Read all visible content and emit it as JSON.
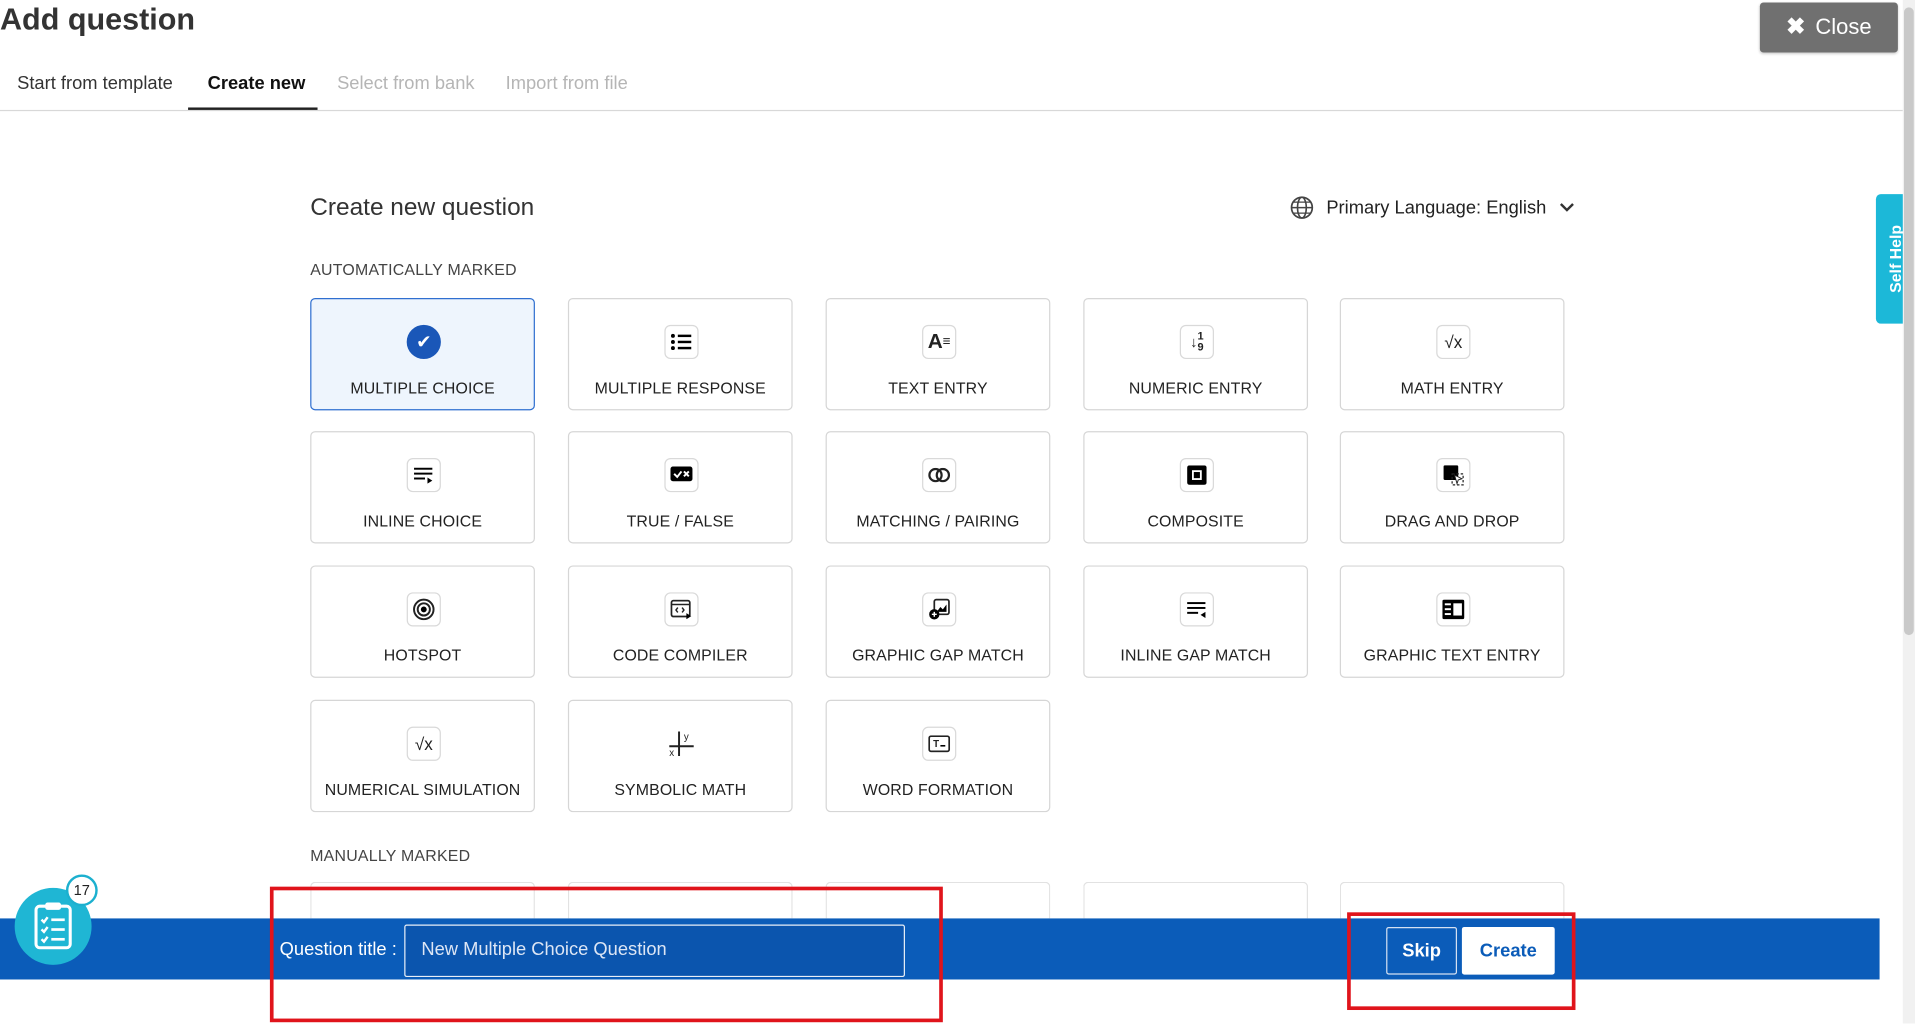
{
  "header": {
    "title": "Add question",
    "close_label": "Close"
  },
  "tabs": [
    {
      "label": "Start from template",
      "state": "normal"
    },
    {
      "label": "Create new",
      "state": "active"
    },
    {
      "label": "Select from bank",
      "state": "disabled"
    },
    {
      "label": "Import from file",
      "state": "disabled"
    }
  ],
  "main": {
    "section_title": "Create new question",
    "language_label": "Primary Language: English",
    "auto_label": "AUTOMATICALLY MARKED",
    "manual_label": "MANUALLY MARKED",
    "question_types": [
      {
        "label": "MULTIPLE CHOICE",
        "icon": "check-circle-icon",
        "selected": true
      },
      {
        "label": "MULTIPLE RESPONSE",
        "icon": "list-icon"
      },
      {
        "label": "TEXT ENTRY",
        "icon": "text-entry-icon"
      },
      {
        "label": "NUMERIC ENTRY",
        "icon": "numeric-sort-icon"
      },
      {
        "label": "MATH ENTRY",
        "icon": "sqrt-icon"
      },
      {
        "label": "INLINE CHOICE",
        "icon": "inline-choice-icon"
      },
      {
        "label": "TRUE / FALSE",
        "icon": "true-false-icon"
      },
      {
        "label": "MATCHING / PAIRING",
        "icon": "matching-icon"
      },
      {
        "label": "COMPOSITE",
        "icon": "composite-icon"
      },
      {
        "label": "DRAG AND DROP",
        "icon": "drag-drop-icon"
      },
      {
        "label": "HOTSPOT",
        "icon": "target-icon"
      },
      {
        "label": "CODE COMPILER",
        "icon": "code-icon"
      },
      {
        "label": "GRAPHIC GAP MATCH",
        "icon": "graphic-gap-icon"
      },
      {
        "label": "INLINE GAP MATCH",
        "icon": "inline-gap-icon"
      },
      {
        "label": "GRAPHIC TEXT ENTRY",
        "icon": "graphic-text-icon"
      },
      {
        "label": "NUMERICAL SIMULATION",
        "icon": "sqrt-icon"
      },
      {
        "label": "SYMBOLIC MATH",
        "icon": "axes-icon"
      },
      {
        "label": "WORD FORMATION",
        "icon": "word-formation-icon"
      }
    ]
  },
  "bottom_bar": {
    "question_title_label": "Question title :",
    "question_title_value": "New Multiple Choice Question",
    "skip_label": "Skip",
    "create_label": "Create"
  },
  "self_help_label": "Self Help",
  "widget_badge": "17",
  "colors": {
    "primary": "#0b5cb9",
    "highlight": "#e0141b",
    "accent": "#1cb8d8"
  }
}
